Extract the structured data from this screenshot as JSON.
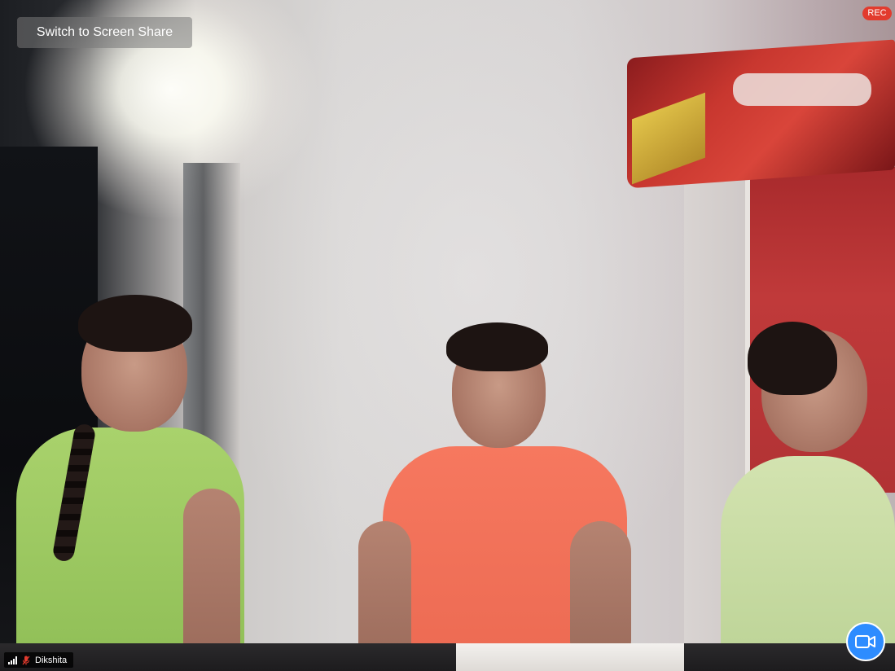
{
  "app": {
    "name": "Video meeting view"
  },
  "overlay": {
    "switch_button_label": "Switch to Screen Share",
    "recording_badge": "REC",
    "participant_name": "Dikshita",
    "participant_mic": "muted",
    "participant_signal": "strong"
  },
  "icons": {
    "signal": "signal-strength-icon",
    "mic": "mic-muted-icon",
    "camera": "video-camera-icon"
  },
  "colors": {
    "rec_badge": "#e23b2e",
    "camera_button": "#2d8cff",
    "mic_muted": "#e23b2e"
  }
}
